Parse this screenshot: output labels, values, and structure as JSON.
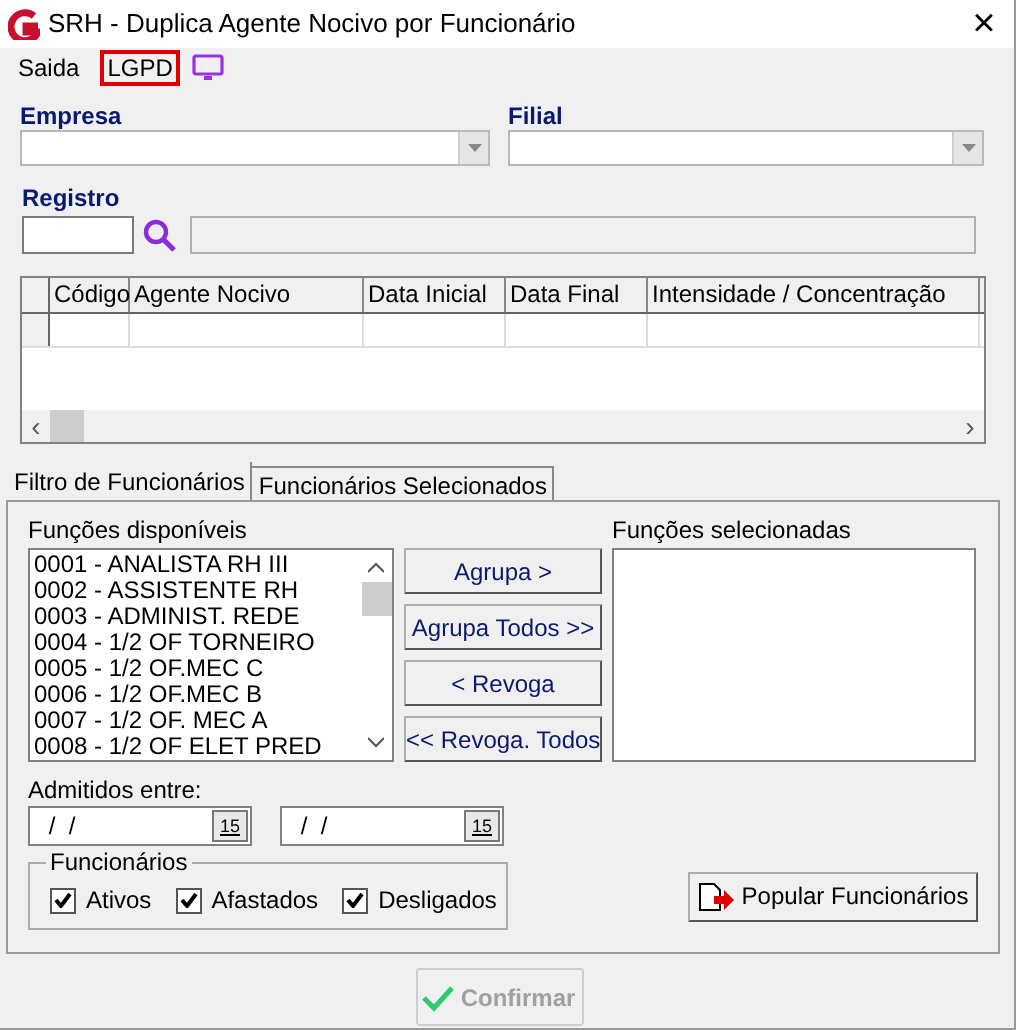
{
  "window": {
    "title": "SRH - Duplica Agente Nocivo por Funcionário",
    "close": "×"
  },
  "menu": [
    {
      "label": "Saida",
      "highlighted": false
    },
    {
      "label": "LGPD",
      "highlighted": true
    }
  ],
  "empresa": {
    "label": "Empresa"
  },
  "filial": {
    "label": "Filial"
  },
  "registro": {
    "label": "Registro"
  },
  "grid": {
    "columns": [
      "Código",
      "Agente Nocivo",
      "Data Inicial",
      "Data Final",
      "Intensidade /  Concentração"
    ],
    "scroll_left": "‹",
    "scroll_right": "›"
  },
  "tabs": [
    {
      "label": "Filtro de Funcionários",
      "selected": true
    },
    {
      "label": "Funcionários Selecionados",
      "selected": false
    }
  ],
  "available": {
    "label": "Funções disponíveis",
    "items": [
      "0001 - ANALISTA RH III",
      "0002 - ASSISTENTE RH",
      "0003 - ADMINIST. REDE",
      "0004 - 1/2 OF TORNEIRO",
      "0005 - 1/2 OF.MEC C",
      "0006 - 1/2 OF.MEC B",
      "0007 - 1/2 OF. MEC A",
      "0008 - 1/2 OF ELET PRED"
    ]
  },
  "move_buttons": [
    "Agrupa >",
    "Agrupa Todos >>",
    "< Revoga",
    "<< Revoga. Todos"
  ],
  "selected_list": {
    "label": "Funções selecionadas"
  },
  "admitidos": {
    "label": "Admitidos entre:",
    "dates": [
      {
        "value": " /  /",
        "calendar": "15"
      },
      {
        "value": " /  /",
        "calendar": "15"
      }
    ]
  },
  "funcionarios": {
    "label": "Funcionários",
    "options": [
      {
        "label": "Ativos",
        "checked": true
      },
      {
        "label": "Afastados",
        "checked": true
      },
      {
        "label": "Desligados",
        "checked": true
      }
    ]
  },
  "populate_button": "Popular Funcionários",
  "confirm_button": {
    "label": "Confirmar",
    "disabled": true
  }
}
